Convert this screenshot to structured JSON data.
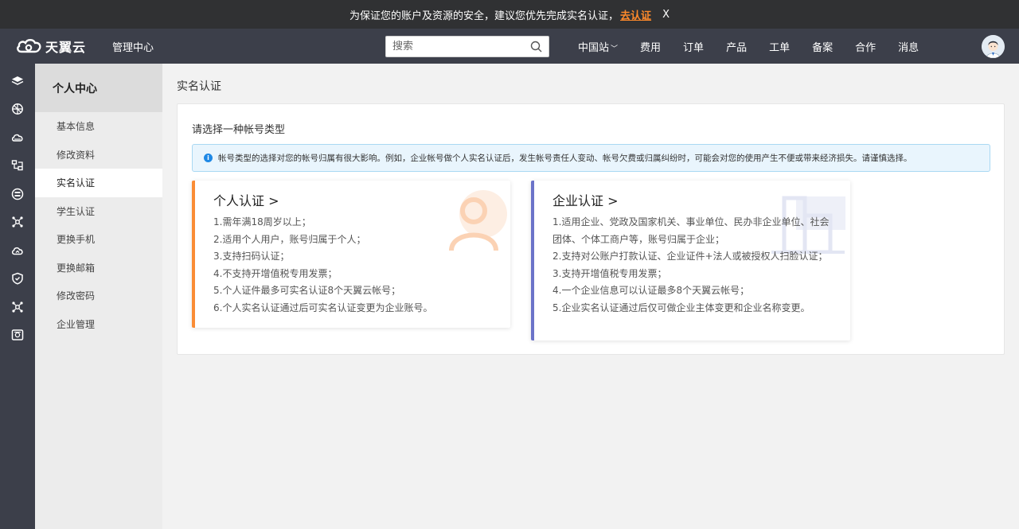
{
  "notice": {
    "text": "为保证您的账户及资源的安全，建议您优先完成实名认证，",
    "link": "去认证",
    "close": "X"
  },
  "header": {
    "logo_text": "天翼云",
    "management": "管理中心",
    "search_placeholder": "搜索",
    "nav": [
      "中国站",
      "费用",
      "订单",
      "产品",
      "工单",
      "备案",
      "合作",
      "消息"
    ]
  },
  "iconbar": {
    "icons": [
      "layers-icon",
      "network-icon",
      "cloud-icon",
      "topology-icon",
      "database-icon",
      "cluster-icon",
      "cloud-sync-icon",
      "shield-icon",
      "nodes-icon",
      "monitor-icon"
    ]
  },
  "subnav": {
    "title": "个人中心",
    "items": [
      "基本信息",
      "修改资料",
      "实名认证",
      "学生认证",
      "更换手机",
      "更换邮箱",
      "修改密码",
      "企业管理"
    ],
    "active_index": 2
  },
  "main": {
    "page_title": "实名认证",
    "panel_title": "请选择一种帐号类型",
    "tip": "帐号类型的选择对您的帐号归属有很大影响。例如，企业帐号做个人实名认证后，发生帐号责任人变动、帐号欠费或归属纠纷时，可能会对您的使用产生不便或带来经济损失。请谨慎选择。",
    "cards": [
      {
        "title": "个人认证 >",
        "accent": "#fa8c35",
        "lines": [
          "1.需年满18周岁以上；",
          "2.适用个人用户，账号归属于个人；",
          "3.支持扫码认证；",
          "4.不支持开增值税专用发票；",
          "5.个人证件最多可实名认证8个天翼云帐号；",
          "6.个人实名认证通过后可实名认证变更为企业账号。"
        ]
      },
      {
        "title": "企业认证 >",
        "accent": "#6b73c9",
        "lines": [
          "1.适用企业、党政及国家机关、事业单位、民办非企业单位、社会团体、个体工商户等，账号归属于企业；",
          "2.支持对公账户打款认证、企业证件+法人或被授权人扫脸认证；",
          "3.支持开增值税专用发票；",
          "4.一个企业信息可以认证最多8个天翼云帐号；",
          "5.企业实名认证通过后仅可做企业主体变更和企业名称变更。"
        ]
      }
    ]
  },
  "colors": {
    "notice_bg": "#303133",
    "header_bg": "#3c3f4a",
    "link": "#ff8a2b",
    "tip_bg": "#e9f5fd",
    "tip_border": "#a9d8f3"
  }
}
